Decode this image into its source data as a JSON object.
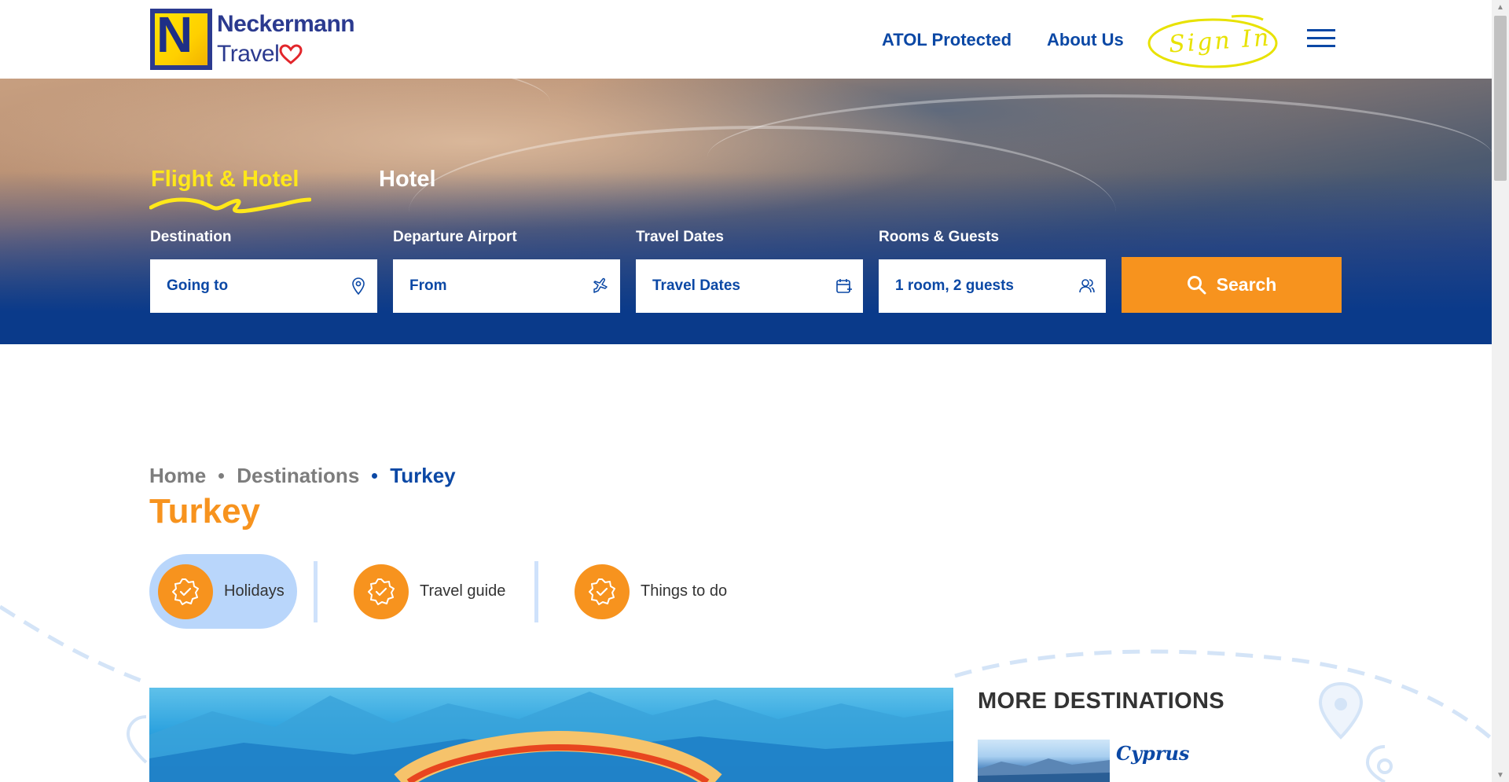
{
  "header": {
    "logo_line1": "Neckermann",
    "logo_line2": "Travel",
    "nav": {
      "atol": "ATOL Protected",
      "about": "About Us",
      "signin": "Sign In"
    }
  },
  "search": {
    "tabs": [
      {
        "label": "Flight & Hotel",
        "active": true
      },
      {
        "label": "Hotel",
        "active": false
      }
    ],
    "fields": [
      {
        "label": "Destination",
        "placeholder": "Going to",
        "icon": "map-pin-icon"
      },
      {
        "label": "Departure Airport",
        "placeholder": "From",
        "icon": "plane-icon"
      },
      {
        "label": "Travel Dates",
        "placeholder": "Travel Dates",
        "icon": "calendar-icon"
      },
      {
        "label": "Rooms & Guests",
        "placeholder": "1 room, 2 guests",
        "icon": "guests-icon"
      }
    ],
    "button_label": "Search"
  },
  "breadcrumb": [
    "Home",
    "Destinations",
    "Turkey"
  ],
  "page_title": "Turkey",
  "sub_tabs": [
    {
      "label": "Holidays",
      "active": true
    },
    {
      "label": "Travel guide",
      "active": false
    },
    {
      "label": "Things to do",
      "active": false
    }
  ],
  "sidebar": {
    "title": "MORE DESTINATIONS",
    "destinations": [
      {
        "name": "Cyprus"
      }
    ]
  },
  "colors": {
    "brand_blue": "#0b48a5",
    "accent_orange": "#f7931e",
    "accent_yellow": "#ffe81a",
    "hero_deep_blue": "#0a3a8a"
  }
}
